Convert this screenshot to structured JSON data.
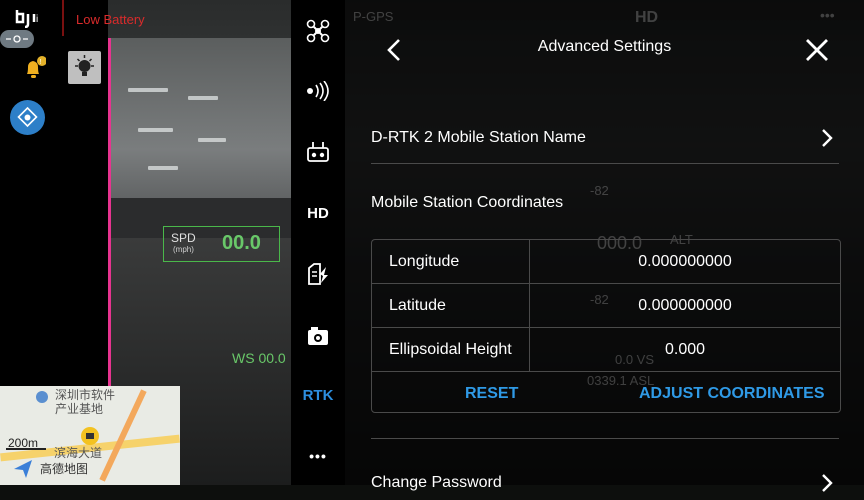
{
  "status": {
    "low_battery": "Low Battery",
    "gps_mode": "P-GPS",
    "hd_label": "HD",
    "menu_dots": "•••"
  },
  "camera_hud": {
    "spd_label": "SPD",
    "spd_unit": "(mph)",
    "spd_value": "00.0",
    "ws_value": "WS 00.0",
    "alt_label": "ALT",
    "alt_value": "000.0",
    "vs_value": "0.0 VS",
    "asl_value": "0339.1 ASL",
    "tick_upper": "-82",
    "tick_lower": "-82"
  },
  "map": {
    "scale": "200m",
    "label_1": "深圳市软件",
    "label_2": "产业基地",
    "label_3": "滨海大道",
    "attribution": "高德地图"
  },
  "side_menu": {
    "items": [
      {
        "name": "aircraft",
        "icon": "aircraft-icon"
      },
      {
        "name": "signal",
        "icon": "signal-broadcast-icon"
      },
      {
        "name": "remote-controller",
        "icon": "remote-controller-icon"
      },
      {
        "name": "hd",
        "label": "HD"
      },
      {
        "name": "battery",
        "icon": "battery-icon"
      },
      {
        "name": "camera",
        "icon": "camera-icon"
      },
      {
        "name": "rtk",
        "label": "RTK",
        "active": true
      },
      {
        "name": "more",
        "label": "•••"
      }
    ]
  },
  "panel": {
    "title": "Advanced Settings",
    "station_name_label": "D-RTK 2 Mobile Station Name",
    "coordinates_heading": "Mobile Station Coordinates",
    "coordinates": [
      {
        "label": "Longitude",
        "value": "0.000000000"
      },
      {
        "label": "Latitude",
        "value": "0.000000000"
      },
      {
        "label": "Ellipsoidal Height",
        "value": "0.000"
      }
    ],
    "reset_label": "RESET",
    "adjust_label": "ADJUST COORDINATES",
    "change_password_label": "Change Password"
  },
  "colors": {
    "accent": "#2f9ae6",
    "warning": "#d92b2b",
    "hud_green": "#69c869"
  }
}
